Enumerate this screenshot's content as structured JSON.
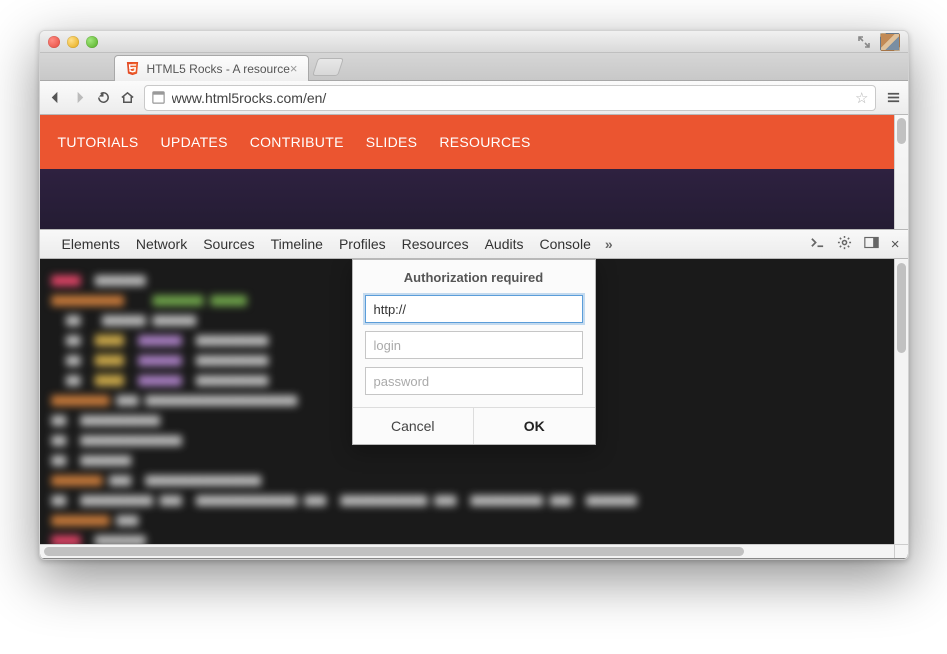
{
  "window": {
    "tab_title": "HTML5 Rocks - A resource"
  },
  "toolbar": {
    "url": "www.html5rocks.com/en/"
  },
  "nav": {
    "items": [
      "TUTORIALS",
      "UPDATES",
      "CONTRIBUTE",
      "SLIDES",
      "RESOURCES"
    ]
  },
  "devtools": {
    "tabs": [
      "Elements",
      "Network",
      "Sources",
      "Timeline",
      "Profiles",
      "Resources",
      "Audits",
      "Console"
    ]
  },
  "dialog": {
    "title": "Authorization required",
    "url_value": "http://",
    "login_placeholder": "login",
    "password_placeholder": "password",
    "cancel": "Cancel",
    "ok": "OK"
  }
}
